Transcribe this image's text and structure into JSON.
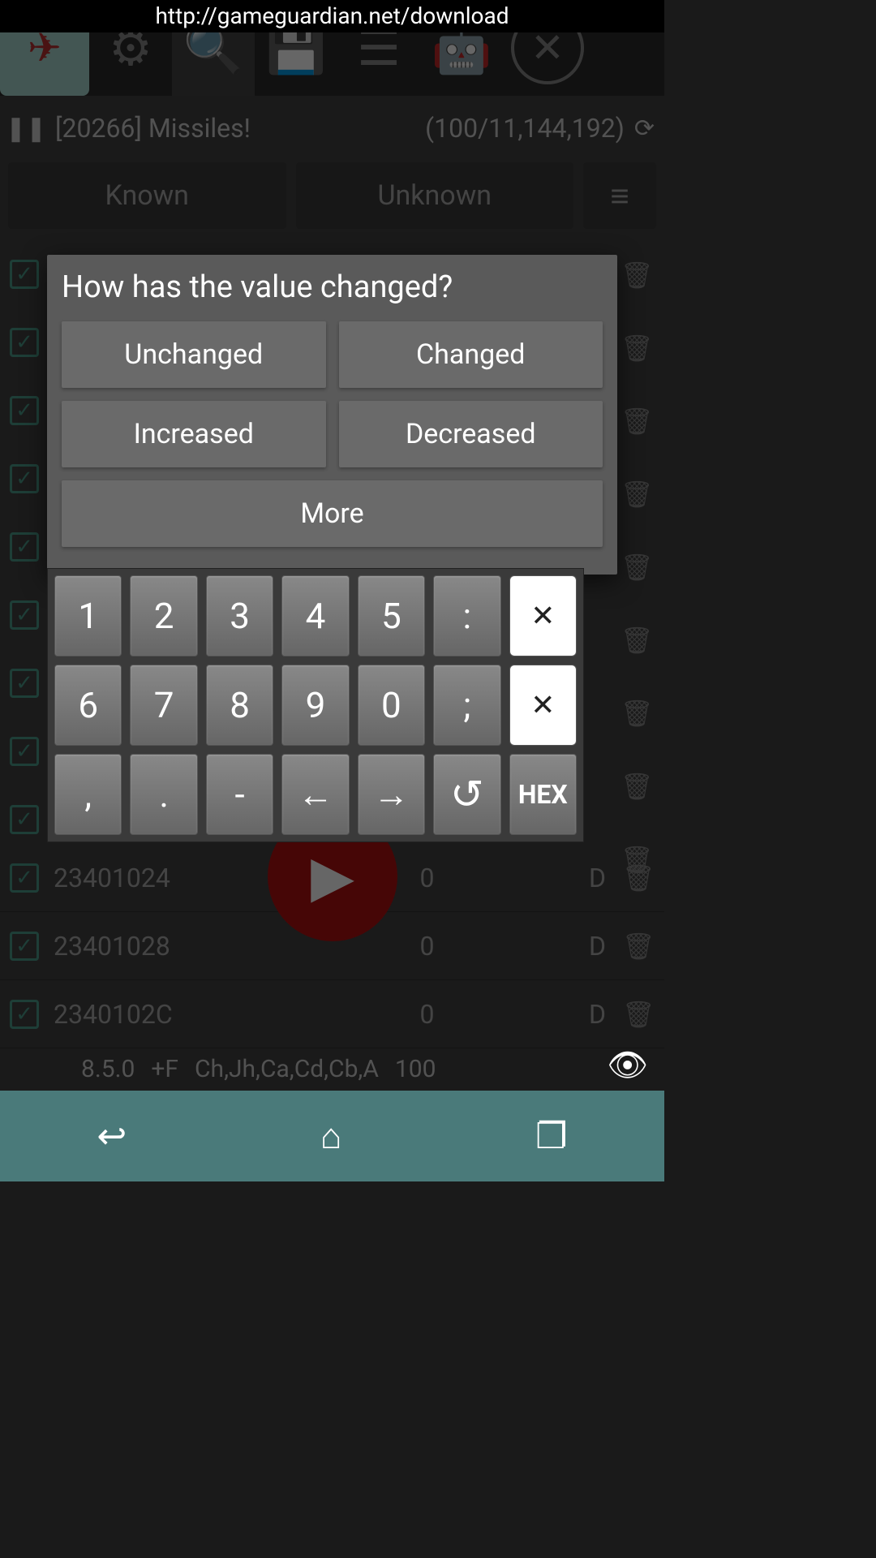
{
  "url": "http://gameguardian.net/download",
  "process": "[20266] Missiles!",
  "count": "(100/11,144,192)",
  "filters": {
    "known": "Known",
    "unknown": "Unknown"
  },
  "modal": {
    "title": "How has the value changed?",
    "unchanged": "Unchanged",
    "changed": "Changed",
    "increased": "Increased",
    "decreased": "Decreased",
    "more": "More"
  },
  "keypad": {
    "k1": "1",
    "k2": "2",
    "k3": "3",
    "k4": "4",
    "k5": "5",
    "colon": ":",
    "k6": "6",
    "k7": "7",
    "k8": "8",
    "k9": "9",
    "k0": "0",
    "semi": ";",
    "comma": ",",
    "dot": ".",
    "dash": "-",
    "left": "←",
    "right": "→",
    "hex": "HEX"
  },
  "rows": [
    {
      "addr": "23401024",
      "val": "0",
      "type": "D"
    },
    {
      "addr": "23401028",
      "val": "0",
      "type": "D"
    },
    {
      "addr": "2340102C",
      "val": "0",
      "type": "D"
    }
  ],
  "status": {
    "version": "8.5.0",
    "flags": "+F",
    "regions": "Ch,Jh,Ca,Cd,Cb,A",
    "num": "100"
  }
}
